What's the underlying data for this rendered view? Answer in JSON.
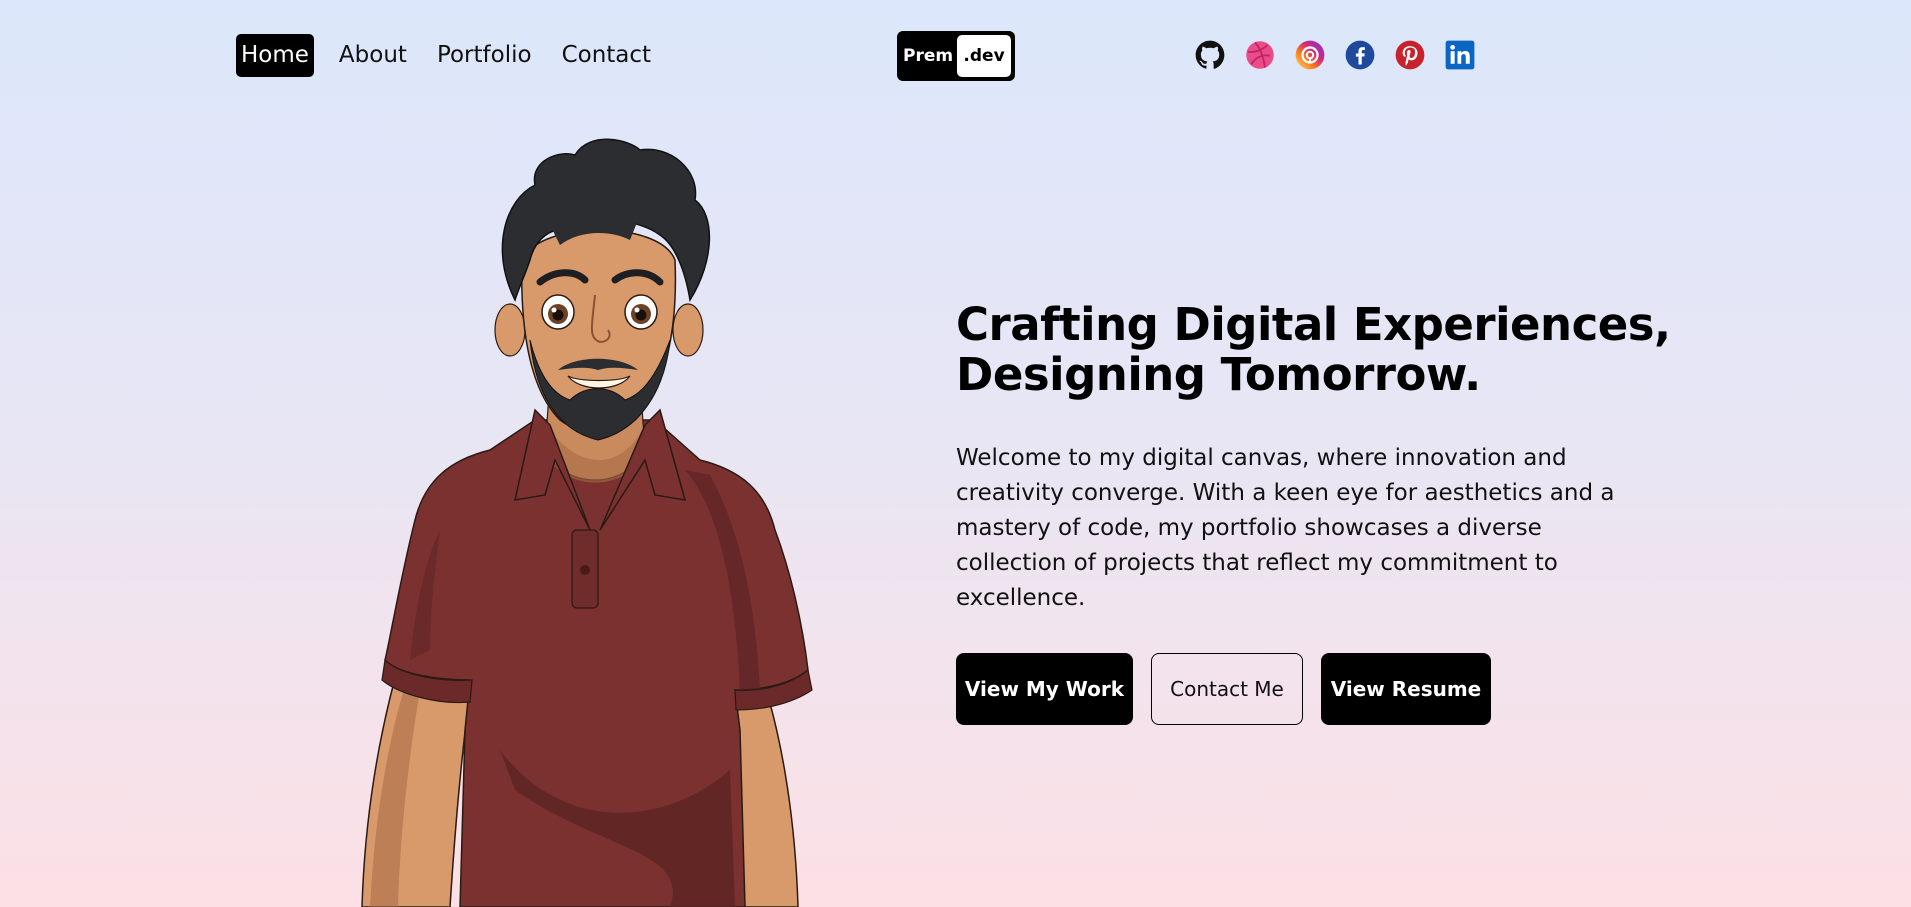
{
  "nav": {
    "items": [
      {
        "label": "Home",
        "active": true
      },
      {
        "label": "About",
        "active": false
      },
      {
        "label": "Portfolio",
        "active": false
      },
      {
        "label": "Contact",
        "active": false
      }
    ]
  },
  "logo": {
    "left_text": "Prem",
    "right_text": ".dev"
  },
  "socials": [
    {
      "icon": "github-icon",
      "color": "#181717"
    },
    {
      "icon": "dribbble-icon",
      "color": "#ea4c89"
    },
    {
      "icon": "instagram-icon",
      "color": "#c13584"
    },
    {
      "icon": "facebook-icon",
      "color": "#1877f2"
    },
    {
      "icon": "pinterest-icon",
      "color": "#e60023"
    },
    {
      "icon": "linkedin-icon",
      "color": "#0a66c2"
    }
  ],
  "hero": {
    "headline_line1": "Crafting Digital Experiences,",
    "headline_line2": "Designing Tomorrow.",
    "intro_lines": [
      "Welcome to my digital canvas, where innovation and",
      "creativity converge. With a keen eye for aesthetics and a",
      "mastery of code, my portfolio showcases a diverse",
      "collection of projects that reflect my commitment to",
      "excellence."
    ],
    "buttons": [
      {
        "label": "View My Work",
        "style": "dark"
      },
      {
        "label": "Contact Me",
        "style": "outline"
      },
      {
        "label": "View Resume",
        "style": "dark"
      }
    ]
  },
  "colors": {
    "background_top": "#dce7fb",
    "background_bottom": "#fce0e5",
    "shirt": "#7a3130",
    "skin": "#d89a6b",
    "hair": "#2b2d31"
  }
}
